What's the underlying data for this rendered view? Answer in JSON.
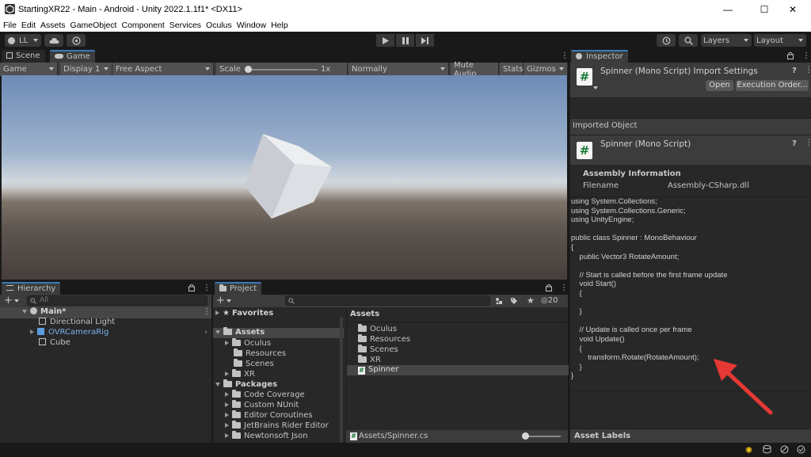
{
  "window": {
    "title": "StartingXR22 - Main - Android - Unity 2022.1.1f1* <DX11>",
    "minimize": "—",
    "maximize": "☐",
    "close": "✕"
  },
  "menu": [
    "File",
    "Edit",
    "Assets",
    "GameObject",
    "Component",
    "Services",
    "Oculus",
    "Window",
    "Help"
  ],
  "toolbar": {
    "account": "LL",
    "layers": "Layers",
    "layout": "Layout"
  },
  "scene_tabs": {
    "scene": "Scene",
    "game": "Game"
  },
  "game_controls": {
    "mode": "Game",
    "display": "Display 1",
    "aspect": "Free Aspect",
    "scale_label": "Scale",
    "scale_value": "1x",
    "scale_slider": 0.02,
    "play_mode": "Normally",
    "mute": "Mute Audio",
    "stats": "Stats",
    "gizmos": "Gizmos"
  },
  "hierarchy": {
    "tab": "Hierarchy",
    "search_placeholder": "All",
    "scene": "Main*",
    "items": [
      "Directional Light",
      "OVRCameraRig",
      "Cube"
    ]
  },
  "project": {
    "tab": "Project",
    "favorites": "Favorites",
    "assets": "Assets",
    "asset_folders": [
      "Oculus",
      "Resources",
      "Scenes",
      "XR"
    ],
    "packages": "Packages",
    "package_folders": [
      "Code Coverage",
      "Custom NUnit",
      "Editor Coroutines",
      "JetBrains Rider Editor",
      "Newtonsoft Json"
    ],
    "right_header": "Assets",
    "right_items": [
      "Oculus",
      "Resources",
      "Scenes",
      "XR"
    ],
    "selected_item": "Spinner",
    "hidden_count": "20",
    "path": "Assets/Spinner.cs"
  },
  "inspector": {
    "tab": "Inspector",
    "import_title": "Spinner (Mono Script) Import Settings",
    "open_button": "Open",
    "exec_button": "Execution Order...",
    "imported_object": "Imported Object",
    "object_title": "Spinner (Mono Script)",
    "assembly_info": "Assembly Information",
    "filename_label": "Filename",
    "filename_value": "Assembly-CSharp.dll",
    "code": "using System.Collections;\nusing System.Collections.Generic;\nusing UnityEngine;\n\npublic class Spinner : MonoBehaviour\n{\n    public Vector3 RotateAmount;\n\n    // Start is called before the first frame update\n    void Start()\n    {\n\n    }\n\n    // Update is called once per frame\n    void Update()\n    {\n        transform.Rotate(RotateAmount);\n    }\n}",
    "asset_labels": "Asset Labels"
  },
  "colors": {
    "accent_blue": "#3a79bb",
    "prefab_blue": "#7bb0ea",
    "annotation_red": "#e53935",
    "script_green": "#1a7a35"
  }
}
